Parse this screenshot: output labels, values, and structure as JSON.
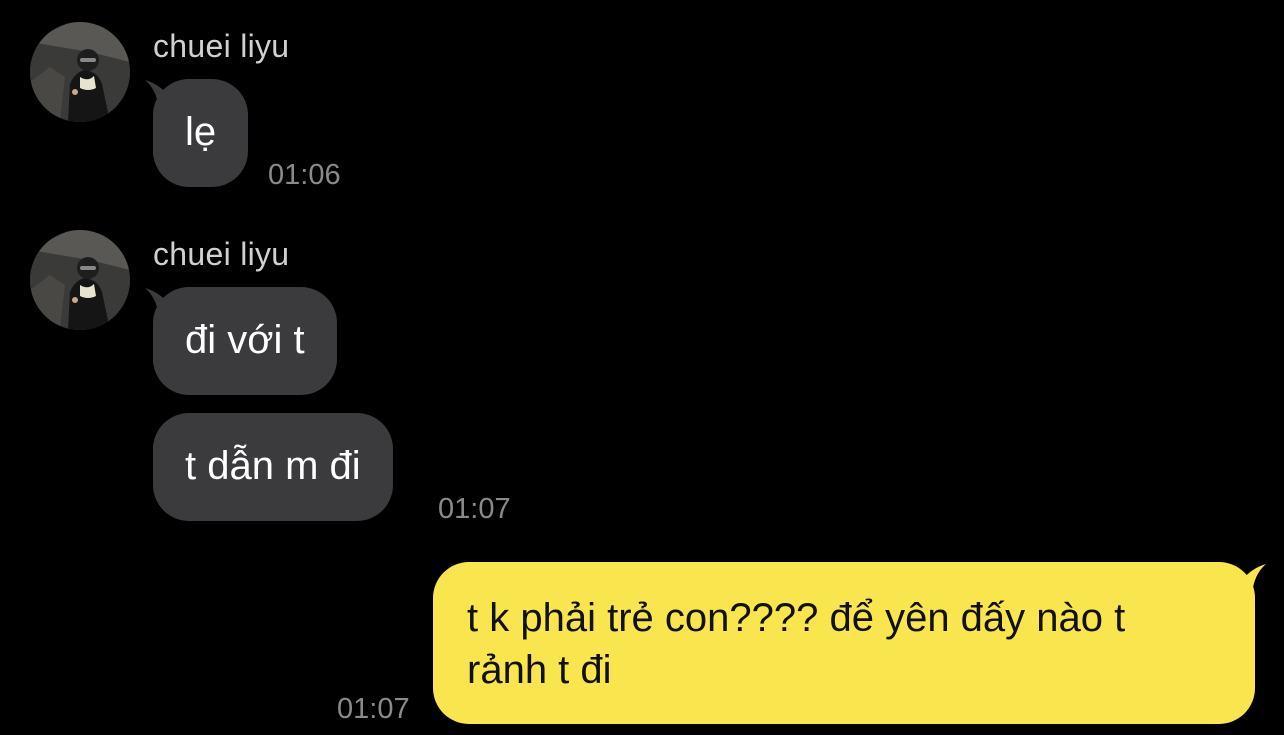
{
  "colors": {
    "background": "#000000",
    "incoming_bubble": "#3b3b3d",
    "outgoing_bubble": "#f9e64e",
    "name_text": "#d0d0d0",
    "timestamp_text": "#8a8a8a"
  },
  "conversation": {
    "groups": [
      {
        "sender": "chuei liyu",
        "avatar_icon": "profile-photo",
        "messages": [
          {
            "text": "lẹ"
          }
        ],
        "time": "01:06"
      },
      {
        "sender": "chuei liyu",
        "avatar_icon": "profile-photo",
        "messages": [
          {
            "text": "đi với t"
          },
          {
            "text": "t dẫn m đi"
          }
        ],
        "time": "01:07"
      }
    ],
    "outgoing": {
      "lines": [
        "t k phải trẻ con???? để yên đấy nào t",
        "rảnh t đi"
      ],
      "time": "01:07"
    }
  }
}
